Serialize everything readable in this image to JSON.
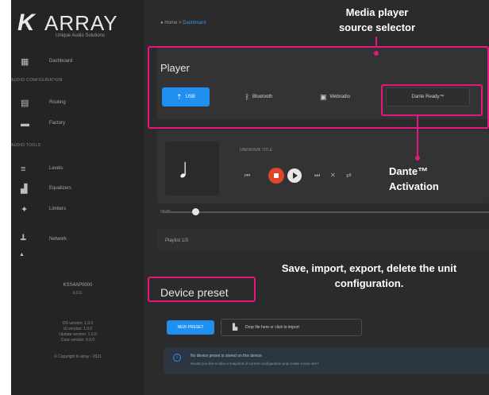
{
  "brand": {
    "logo_mark": "K",
    "logo_text": "ARRAY",
    "tagline": "Unique Audio Solutions"
  },
  "sidebar": {
    "items_top": [
      {
        "icon": "dashboard-icon",
        "label": "Dashboard"
      }
    ],
    "section_audio": "AUDIO CONFIGURATION",
    "items_audio": [
      {
        "icon": "routing-icon",
        "label": "Routing"
      },
      {
        "icon": "factory-icon",
        "label": "Factory"
      }
    ],
    "section_tools": "AUDIO TOOLS",
    "items_tools": [
      {
        "icon": "levels-icon",
        "label": "Levels"
      },
      {
        "icon": "equalizer-icon",
        "label": "Equalizers"
      },
      {
        "icon": "limiters-icon",
        "label": "Limiters"
      }
    ],
    "items_bottom": [
      {
        "icon": "network-icon",
        "label": "Network"
      }
    ],
    "device_name": "KSS4AP0000",
    "device_sub": "0.0.0.",
    "versions": [
      "OS version: 1.0.0",
      "UI version: 1.0.0",
      "Update version: 1.0.0",
      "Core version: 0.0.0"
    ],
    "copyright": "© Copyright K-array - 2021"
  },
  "breadcrumb": {
    "home": "Home",
    "separator": ">",
    "current": "Dashboard"
  },
  "player": {
    "title": "Player",
    "sources": [
      {
        "icon": "usb-icon",
        "label": "USB",
        "active": true
      },
      {
        "icon": "bluetooth-icon",
        "label": "Bluetooth",
        "active": false
      },
      {
        "icon": "radio-icon",
        "label": "Webradio",
        "active": false
      },
      {
        "icon": "",
        "label": "Dante Ready™",
        "active": false
      }
    ],
    "now_playing_label": "UNKNOWN TITLE",
    "controls": {
      "prev": "⏮",
      "next": "⏭",
      "shuffle": "✕",
      "repeat": "⇄"
    },
    "time": "00:00",
    "playlist": "Playlist 1/3"
  },
  "preset": {
    "title": "Device preset",
    "new_button": "NEW PRESET",
    "drop_text": "Drop file here or click to import",
    "info_title": "No device preset is stored on this device",
    "info_sub": "Would you like to take a snapshot of current configuration and create a new one?"
  },
  "annotations": {
    "source_selector": [
      "Media player",
      "source selector"
    ],
    "dante": [
      "Dante™",
      "Activation"
    ],
    "preset": [
      "Save, import, export, delete the unit",
      "configuration."
    ]
  },
  "colors": {
    "accent": "#1f8ff0",
    "highlight": "#e6157f",
    "stop": "#e0452c",
    "bg": "#2b2b2b"
  }
}
